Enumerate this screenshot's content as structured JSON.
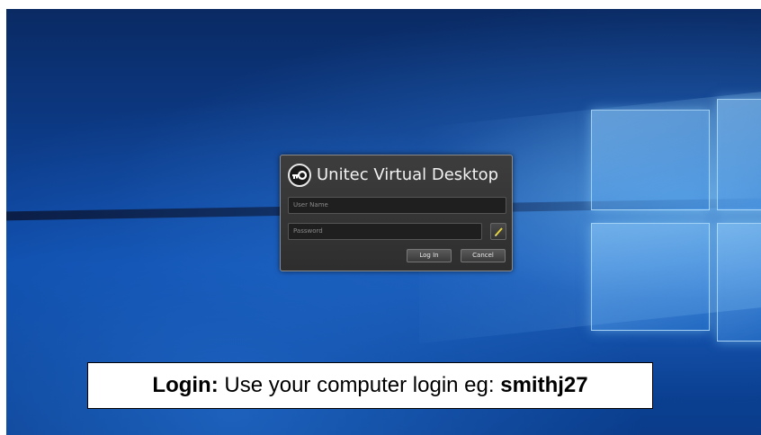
{
  "dialog": {
    "title": "Unitec Virtual Desktop",
    "logo_icon": "key-logo-icon",
    "username_placeholder": "User Name",
    "username_value": "",
    "password_placeholder": "Password",
    "password_value": "",
    "password_button_icon": "pencil-icon",
    "login_label": "Log In",
    "cancel_label": "Cancel"
  },
  "caption": {
    "label": "Login:",
    "text": " Use your computer login eg: ",
    "example": "smithj27"
  },
  "colors": {
    "desktop_accent": "#0d4aa8",
    "dialog_bg": "#3a3a3a",
    "pencil_accent": "#e6d23a"
  }
}
